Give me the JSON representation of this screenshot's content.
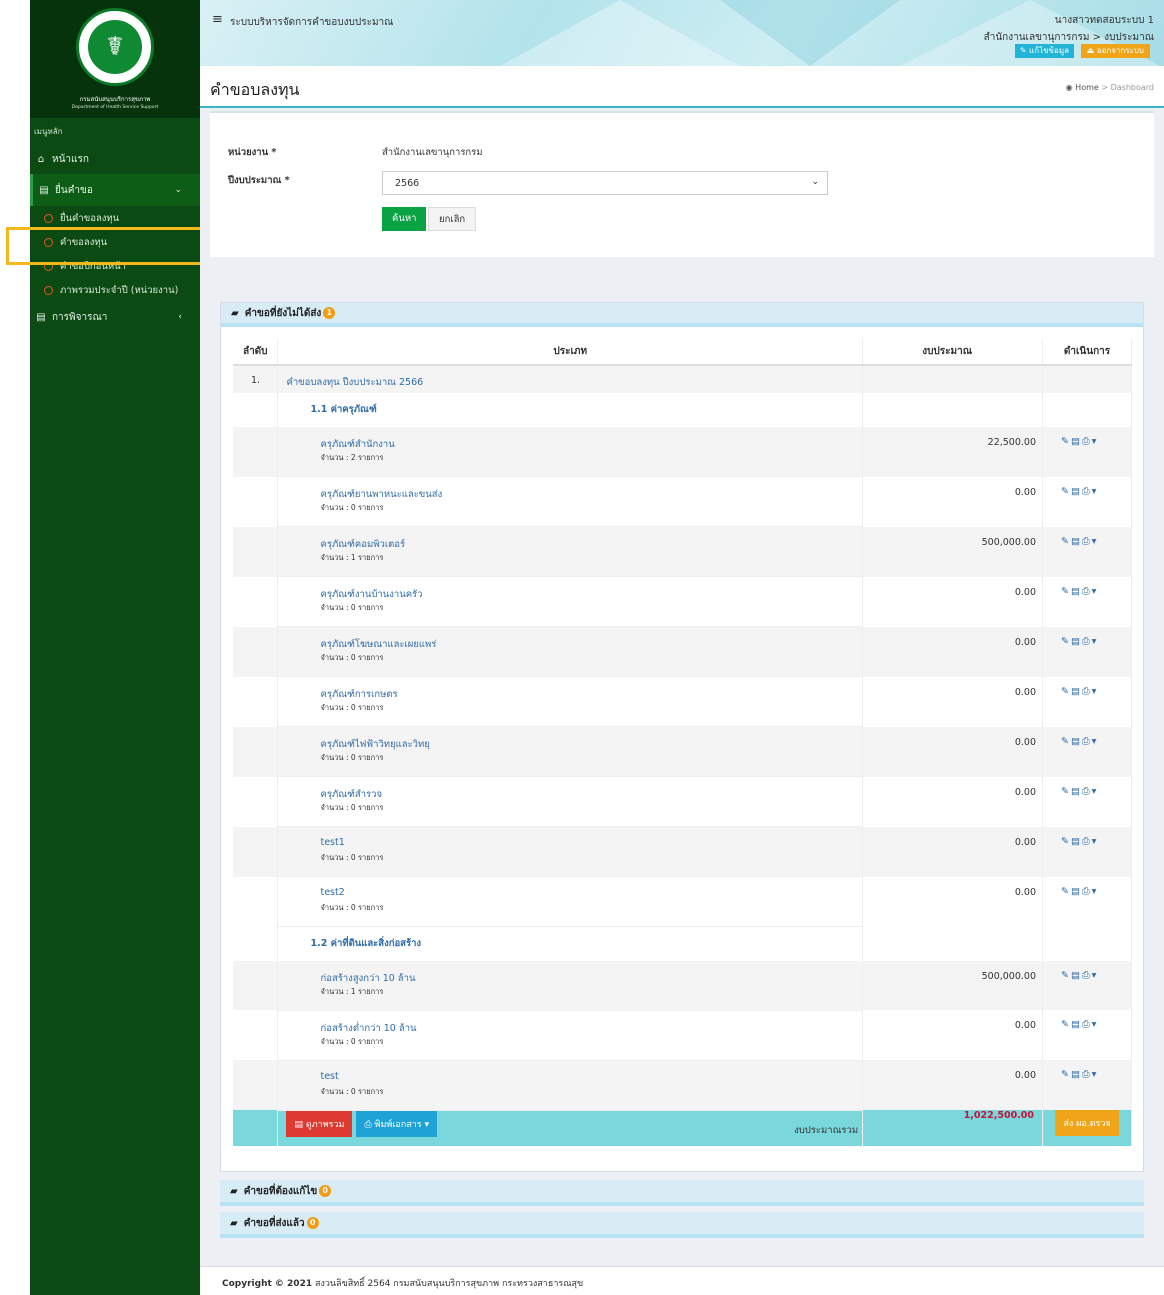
{
  "header": {
    "system_title": "ระบบบริหารจัดการคำขอบงบประมาณ",
    "user_name": "นางสาวทดสอบระบบ 1",
    "department": "สำนักงานเลขานุการกรม > งบประมาณ",
    "edit_profile_label": "แก้ไขข้อมูล",
    "logout_label": "ออกจากระบบ"
  },
  "brand": {
    "org_th": "กรมสนับสนุนบริการสุขภาพ",
    "org_en": "Department of Health Service Support"
  },
  "sidebar": {
    "menu_header": "เมนูหลัก",
    "home": "หน้าแรก",
    "submit_group": "ยื่นคำขอ",
    "sub_items": [
      "ยื่นคำขอลงทุน",
      "คำขอลงทุน",
      "คำขอปีก่อนหน้า",
      "ภาพรวมประจำปี (หน่วยงาน)"
    ],
    "review": "การพิจารณา"
  },
  "page": {
    "title": "คำขอบลงทุน",
    "breadcrumb_home": "Home",
    "breadcrumb_current": "Dashboard"
  },
  "search": {
    "unit_label": "หน่วยงาน *",
    "unit_value": "สำนักงานเลขานุการกรม",
    "year_label": "ปีงบประมาณ *",
    "year_value": "2566",
    "search_button": "ค้นหา",
    "cancel_button": "ยกเลิก"
  },
  "panel": {
    "title": "คำขอที่ยังไม่ได้ส่ง",
    "badge": "1",
    "columns": [
      "ลำดับ",
      "ประเภท",
      "งบประมาณ",
      "ดำเนินการ"
    ],
    "group_no": "1.",
    "group_name": "คำขอบลงทุน ปีงบประมาณ 2566",
    "category1": "1.1 ค่าครุภัณฑ์",
    "category2": "1.2 ค่าที่ดินและสิ่งก่อสร้าง",
    "items_cat1": [
      {
        "name": "ครุภัณฑ์สำนักงาน",
        "count": "จำนวน : 2 รายการ",
        "amount": "22,500.00"
      },
      {
        "name": "ครุภัณฑ์ยานพาหนะและขนส่ง",
        "count": "จำนวน : 0 รายการ",
        "amount": "0.00"
      },
      {
        "name": "ครุภัณฑ์คอมพิวเตอร์",
        "count": "จำนวน : 1 รายการ",
        "amount": "500,000.00"
      },
      {
        "name": "ครุภัณฑ์งานบ้านงานครัว",
        "count": "จำนวน : 0 รายการ",
        "amount": "0.00"
      },
      {
        "name": "ครุภัณฑ์โฆษณาและเผยแพร่",
        "count": "จำนวน : 0 รายการ",
        "amount": "0.00"
      },
      {
        "name": "ครุภัณฑ์การเกษตร",
        "count": "จำนวน : 0 รายการ",
        "amount": "0.00"
      },
      {
        "name": "ครุภัณฑ์ไฟฟ้าวิทยุและวิทยุ",
        "count": "จำนวน : 0 รายการ",
        "amount": "0.00"
      },
      {
        "name": "ครุภัณฑ์สำรวจ",
        "count": "จำนวน : 0 รายการ",
        "amount": "0.00"
      },
      {
        "name": "test1",
        "count": "จำนวน : 0 รายการ",
        "amount": "0.00"
      },
      {
        "name": "test2",
        "count": "จำนวน : 0 รายการ",
        "amount": "0.00"
      }
    ],
    "items_cat2": [
      {
        "name": "ก่อสร้างสูงกว่า 10 ล้าน",
        "count": "จำนวน : 1 รายการ",
        "amount": "500,000.00"
      },
      {
        "name": "ก่อสร้างต่ำกว่า 10 ล้าน",
        "count": "จำนวน : 0 รายการ",
        "amount": "0.00"
      },
      {
        "name": "test",
        "count": "จำนวน : 0 รายการ",
        "amount": "0.00"
      }
    ],
    "overview_button": "ดูภาพรวม",
    "print_button": "พิมพ์เอกสาร",
    "total_label": "งบประมาณรวม",
    "total_value": "1,022,500.00",
    "send_button": "ส่ง ผอ.ตรวจ"
  },
  "panel_edit": {
    "title": "คำขอที่ต้องแก้ไข",
    "badge": "0"
  },
  "panel_sent": {
    "title": "คำขอที่ส่งแล้ว",
    "badge": "0"
  },
  "footer": {
    "copyright": "Copyright © 2021",
    "text": " สงวนลิขสิทธิ์ 2564 กรมสนับสนุนบริการสุขภาพ กระทรวงสาธารณสุข"
  },
  "colors": {
    "sidebar": "#0b4a12",
    "accent": "#3cb4c8",
    "total_row": "#7ad7dc",
    "highlight": "#f2b81c"
  }
}
